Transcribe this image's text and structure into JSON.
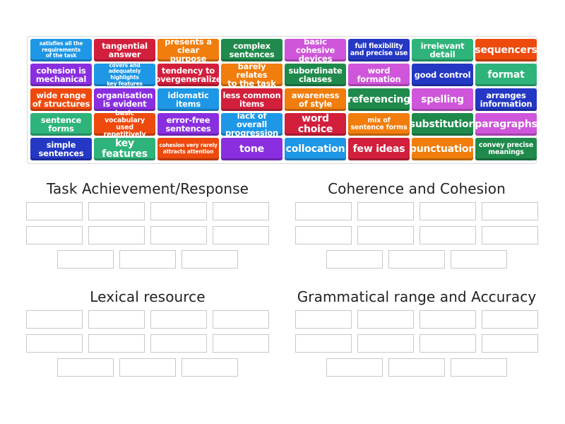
{
  "palette": {
    "blue": "#1e97e6",
    "red": "#d21f3c",
    "orange": "#f07d0c",
    "green": "#1f8a4c",
    "magenta": "#cf55da",
    "navy": "#2438c4",
    "teal": "#2eb47a",
    "redorange": "#ee4a0d",
    "purple": "#8a2fe0"
  },
  "tiles": [
    {
      "text": "satisfies all the\nrequirements\nof the task",
      "color": "blue",
      "size": "xs"
    },
    {
      "text": "tangential\nanswer",
      "color": "red",
      "size": "m"
    },
    {
      "text": "presents a\nclear purpose",
      "color": "orange",
      "size": "m"
    },
    {
      "text": "complex\nsentences",
      "color": "green",
      "size": "m"
    },
    {
      "text": "basic cohesive\ndevices",
      "color": "magenta",
      "size": "m"
    },
    {
      "text": "full flexibility\nand precise use",
      "color": "navy",
      "size": "s"
    },
    {
      "text": "irrelevant\ndetail",
      "color": "teal",
      "size": "m"
    },
    {
      "text": "sequencers",
      "color": "redorange",
      "size": "l"
    },
    {
      "text": "cohesion is\nmechanical",
      "color": "purple",
      "size": "m"
    },
    {
      "text": "covers and\nadequately highlights\nkey features",
      "color": "blue",
      "size": "xs"
    },
    {
      "text": "tendency to\novergeneralize",
      "color": "red",
      "size": "m"
    },
    {
      "text": "barely relates\nto the task",
      "color": "orange",
      "size": "m"
    },
    {
      "text": "subordinate\nclauses",
      "color": "green",
      "size": "m"
    },
    {
      "text": "word\nformation",
      "color": "magenta",
      "size": "m"
    },
    {
      "text": "good control",
      "color": "navy",
      "size": "m"
    },
    {
      "text": "format",
      "color": "teal",
      "size": "l"
    },
    {
      "text": "wide range\nof structures",
      "color": "redorange",
      "size": "m"
    },
    {
      "text": "organisation\nis evident",
      "color": "purple",
      "size": "m"
    },
    {
      "text": "idiomatic\nitems",
      "color": "blue",
      "size": "m"
    },
    {
      "text": "less common\nitems",
      "color": "red",
      "size": "m"
    },
    {
      "text": "awareness\nof style",
      "color": "orange",
      "size": "m"
    },
    {
      "text": "referencing",
      "color": "green",
      "size": "l"
    },
    {
      "text": "spelling",
      "color": "magenta",
      "size": "l"
    },
    {
      "text": "arranges\ninformation",
      "color": "navy",
      "size": "m"
    },
    {
      "text": "sentence\nforms",
      "color": "teal",
      "size": "m"
    },
    {
      "text": "basic vocabulary\nused repetitively",
      "color": "redorange",
      "size": "s"
    },
    {
      "text": "error-free\nsentences",
      "color": "purple",
      "size": "m"
    },
    {
      "text": "lack of overall\nprogression",
      "color": "blue",
      "size": "m"
    },
    {
      "text": "word choice",
      "color": "red",
      "size": "l"
    },
    {
      "text": "mix of\nsentence forms",
      "color": "orange",
      "size": "s"
    },
    {
      "text": "substitution",
      "color": "green",
      "size": "l"
    },
    {
      "text": "paragraphs",
      "color": "magenta",
      "size": "l"
    },
    {
      "text": "simple\nsentences",
      "color": "navy",
      "size": "m"
    },
    {
      "text": "key features",
      "color": "teal",
      "size": "l"
    },
    {
      "text": "cohesion very rarely\nattracts attention",
      "color": "redorange",
      "size": "xs"
    },
    {
      "text": "tone",
      "color": "purple",
      "size": "l"
    },
    {
      "text": "collocation",
      "color": "blue",
      "size": "l"
    },
    {
      "text": "few ideas",
      "color": "red",
      "size": "l"
    },
    {
      "text": "punctuation",
      "color": "orange",
      "size": "l"
    },
    {
      "text": "convey precise\nmeanings",
      "color": "green",
      "size": "s"
    }
  ],
  "groups": [
    {
      "title": "Task Achievement/Response",
      "slot_count": 11
    },
    {
      "title": "Coherence and Cohesion",
      "slot_count": 11
    },
    {
      "title": "Lexical resource",
      "slot_count": 11
    },
    {
      "title": "Grammatical range and Accuracy",
      "slot_count": 11
    }
  ]
}
